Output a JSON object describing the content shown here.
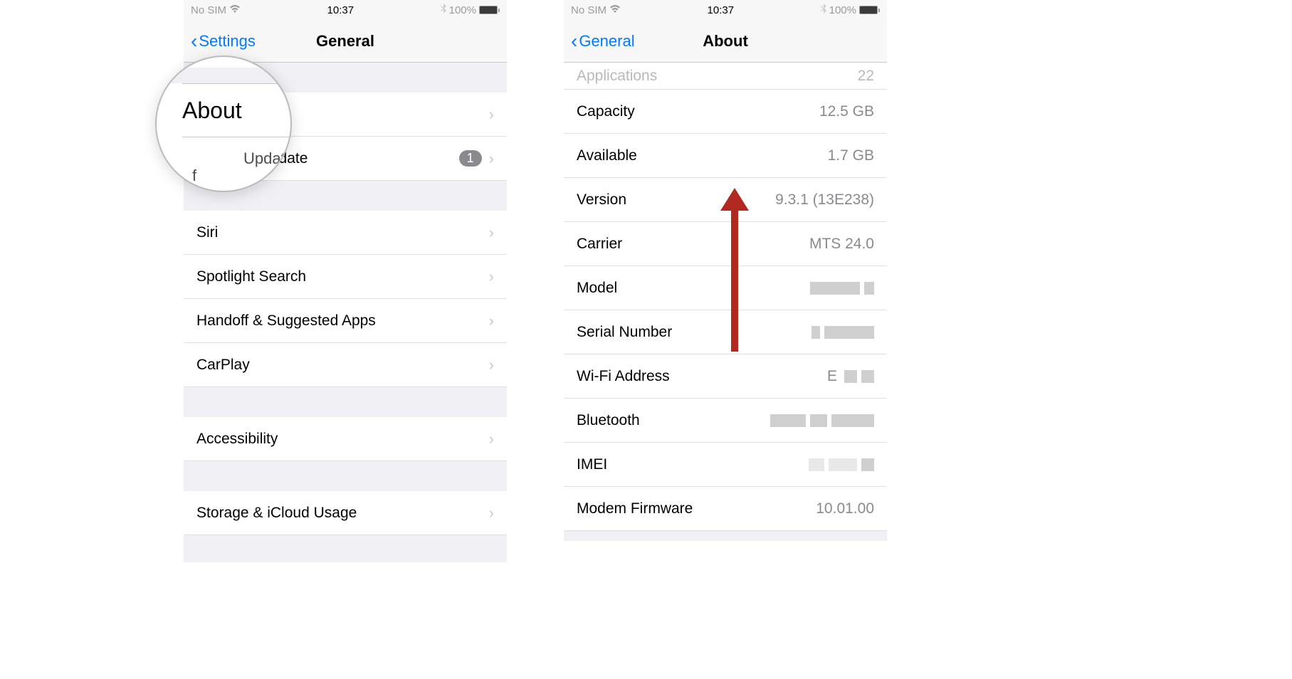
{
  "status": {
    "carrier": "No SIM",
    "time": "10:37",
    "battery": "100%"
  },
  "left": {
    "nav_back": "Settings",
    "nav_title": "General",
    "magnifier": {
      "about": "About",
      "update_partial": "Update",
      "f_char": "f"
    },
    "rows": {
      "about": "About",
      "software_update": "Software Update",
      "badge": "1",
      "siri": "Siri",
      "spotlight": "Spotlight Search",
      "handoff": "Handoff & Suggested Apps",
      "carplay": "CarPlay",
      "accessibility": "Accessibility",
      "storage": "Storage & iCloud Usage"
    }
  },
  "right": {
    "nav_back": "General",
    "nav_title": "About",
    "partial": {
      "label": "Applications",
      "value": "22"
    },
    "rows": {
      "capacity": {
        "label": "Capacity",
        "value": "12.5 GB"
      },
      "available": {
        "label": "Available",
        "value": "1.7 GB"
      },
      "version": {
        "label": "Version",
        "value": "9.3.1 (13E238)"
      },
      "carrier": {
        "label": "Carrier",
        "value": "MTS 24.0"
      },
      "model": {
        "label": "Model"
      },
      "serial": {
        "label": "Serial Number"
      },
      "wifi": {
        "label": "Wi-Fi Address",
        "prefix": "E"
      },
      "bluetooth": {
        "label": "Bluetooth"
      },
      "imei": {
        "label": "IMEI"
      },
      "modem": {
        "label": "Modem Firmware",
        "value": "10.01.00"
      }
    }
  }
}
